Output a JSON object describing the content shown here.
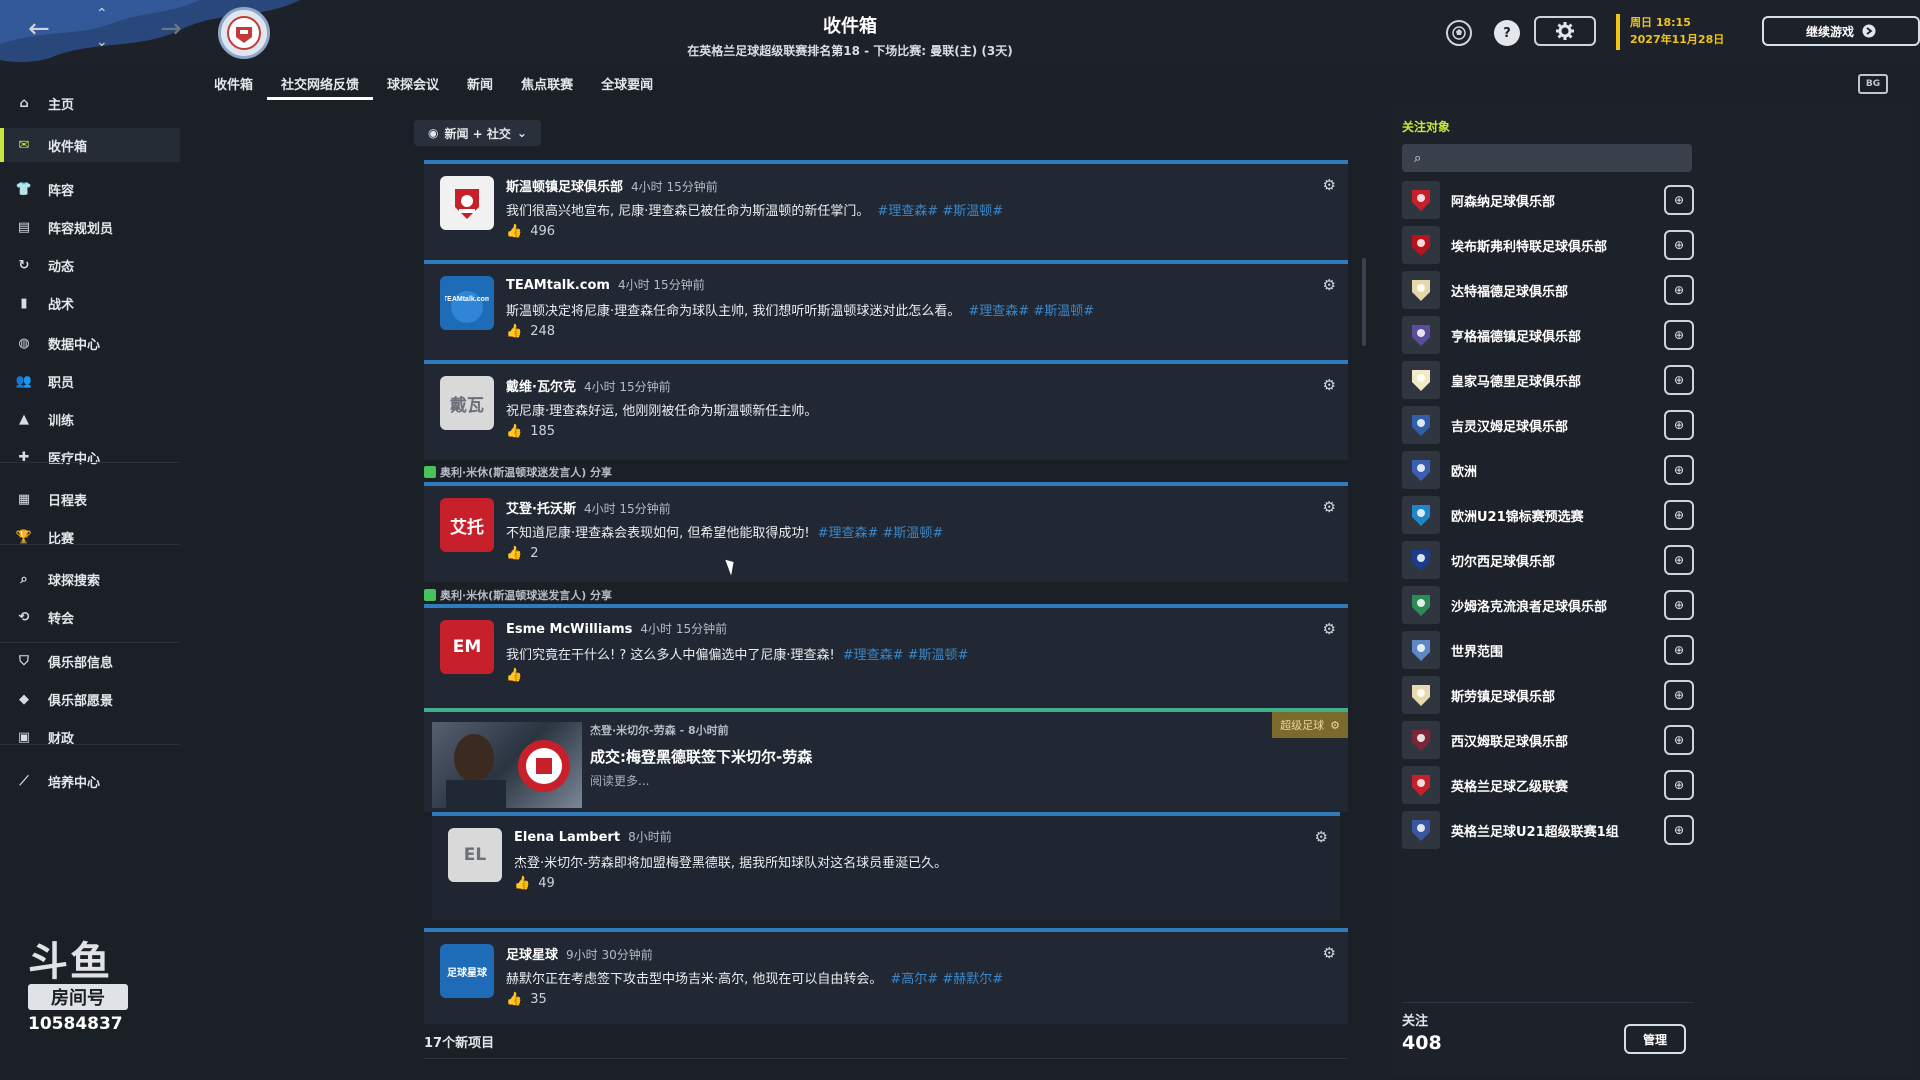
{
  "header": {
    "title": "收件箱",
    "subtitle": "在英格兰足球超级联赛排名第18 - 下场比赛: 曼联(主) (3天)",
    "date_line1": "周日 18:15",
    "date_line2": "2027年11月28日",
    "continue_label": "继续游戏",
    "help_glyph": "?"
  },
  "sidebar": {
    "items": [
      {
        "label": "主页",
        "icon": "home-icon"
      },
      {
        "label": "收件箱",
        "icon": "inbox-icon"
      },
      {
        "label": "阵容",
        "icon": "shirt-icon"
      },
      {
        "label": "阵容规划员",
        "icon": "clipboard-icon"
      },
      {
        "label": "动态",
        "icon": "dynamics-icon"
      },
      {
        "label": "战术",
        "icon": "tactics-icon"
      },
      {
        "label": "数据中心",
        "icon": "data-icon"
      },
      {
        "label": "职员",
        "icon": "staff-icon"
      },
      {
        "label": "训练",
        "icon": "training-icon"
      },
      {
        "label": "医疗中心",
        "icon": "medical-icon"
      },
      {
        "label": "日程表",
        "icon": "calendar-icon"
      },
      {
        "label": "比赛",
        "icon": "trophy-icon"
      },
      {
        "label": "球探搜索",
        "icon": "search-icon"
      },
      {
        "label": "转会",
        "icon": "transfer-icon"
      },
      {
        "label": "俱乐部信息",
        "icon": "shield-icon"
      },
      {
        "label": "俱乐部愿景",
        "icon": "vision-icon"
      },
      {
        "label": "财政",
        "icon": "finance-icon"
      },
      {
        "label": "培养中心",
        "icon": "development-icon"
      }
    ],
    "watermark_brand": "斗鱼",
    "watermark_sub": "房间号",
    "room_number": "10584837"
  },
  "tabs": [
    {
      "label": "收件箱"
    },
    {
      "label": "社交网络反馈"
    },
    {
      "label": "球探会议"
    },
    {
      "label": "新闻"
    },
    {
      "label": "焦点联赛"
    },
    {
      "label": "全球要闻"
    }
  ],
  "feed": {
    "filter_label": "新闻 + 社交",
    "posts": [
      {
        "author": "斯温顿镇足球俱乐部",
        "time": "4小时 15分钟前",
        "text": "我们很高兴地宣布, 尼康·理查森已被任命为斯温顿的新任掌门。",
        "tags": "#理查森# #斯温顿#",
        "likes": "496"
      },
      {
        "author": "TEAMtalk.com",
        "time": "4小时 15分钟前",
        "text": "斯温顿决定将尼康·理查森任命为球队主帅, 我们想听听斯温顿球迷对此怎么看。",
        "tags": "#理查森# #斯温顿#",
        "likes": "248"
      },
      {
        "author": "戴维·瓦尔克",
        "time": "4小时 15分钟前",
        "text": "祝尼康·理查森好运, 他刚刚被任命为斯温顿新任主帅。",
        "tags": "",
        "likes": "185",
        "avatar_text": "戴瓦"
      },
      {
        "author": "艾登·托沃斯",
        "time": "4小时 15分钟前",
        "text": "不知道尼康·理查森会表现如何, 但希望他能取得成功!",
        "tags": "#理查森# #斯温顿#",
        "likes": "2",
        "avatar_text": "艾托"
      },
      {
        "author": "Esme McWilliams",
        "time": "4小时 15分钟前",
        "text": "我们究竟在干什么! ? 这么多人中偏偏选中了尼康·理查森!",
        "tags": "#理查森# #斯温顿#",
        "likes": "",
        "avatar_text": "EM"
      }
    ],
    "share_text": "奥利·米休(斯温顿球迷发言人) 分享",
    "news": {
      "meta": "杰登·米切尔-劳森 - 8小时前",
      "headline": "成交:梅登黑德联签下米切尔-劳森",
      "more": "阅读更多...",
      "badge": "超级足球"
    },
    "reply": {
      "author": "Elena Lambert",
      "time": "8小时前",
      "text": "杰登·米切尔-劳森即将加盟梅登黑德联, 据我所知球队对这名球员垂涎已久。",
      "likes": "49",
      "avatar_text": "EL"
    },
    "last_post": {
      "author": "足球星球",
      "time": "9小时 30分钟前",
      "text": "赫默尔正在考虑签下攻击型中场吉米·高尔, 他现在可以自由转会。",
      "tags": "#高尔# #赫默尔#",
      "likes": "35",
      "avatar_text": "足球星球"
    },
    "new_items": "17个新项目"
  },
  "right_panel": {
    "label": "关注对象",
    "search_placeholder": "",
    "follows": [
      {
        "name": "阿森纳足球俱乐部",
        "color": "#c8202a"
      },
      {
        "name": "埃布斯弗利特联足球俱乐部",
        "color": "#b8131a"
      },
      {
        "name": "达特福德足球俱乐部",
        "color": "#e4d7a8"
      },
      {
        "name": "亨格福德镇足球俱乐部",
        "color": "#5b4c9c"
      },
      {
        "name": "皇家马德里足球俱乐部",
        "color": "#f2e9c6"
      },
      {
        "name": "吉灵汉姆足球俱乐部",
        "color": "#2f5fa8"
      },
      {
        "name": "欧洲",
        "color": "#3a5fb0"
      },
      {
        "name": "欧洲U21锦标赛预选赛",
        "color": "#1f87c9"
      },
      {
        "name": "切尔西足球俱乐部",
        "color": "#1b3c8c"
      },
      {
        "name": "沙姆洛克流浪者足球俱乐部",
        "color": "#2e8b57"
      },
      {
        "name": "世界范围",
        "color": "#5d87c5"
      },
      {
        "name": "斯劳镇足球俱乐部",
        "color": "#e8d9b0"
      },
      {
        "name": "西汉姆联足球俱乐部",
        "color": "#7a2638"
      },
      {
        "name": "英格兰足球乙级联赛",
        "color": "#c8202a"
      },
      {
        "name": "英格兰足球U21超级联赛1组",
        "color": "#3a56a0"
      }
    ],
    "footer_label": "关注",
    "footer_count": "408",
    "manage_label": "管理"
  }
}
